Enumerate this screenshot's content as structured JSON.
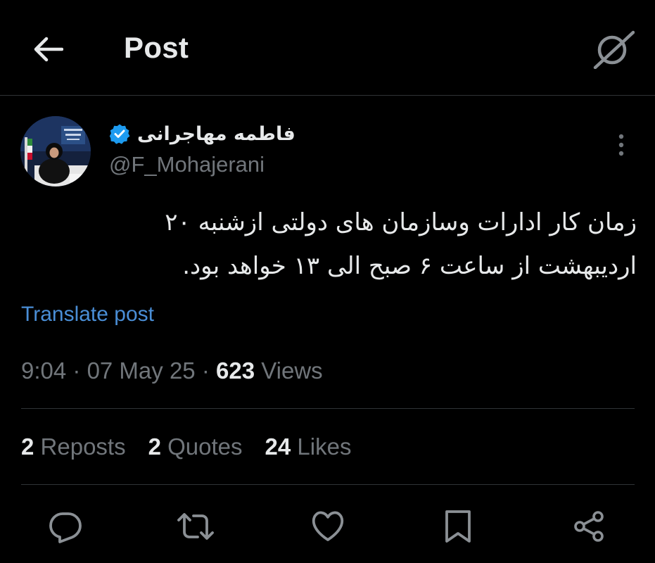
{
  "header": {
    "title": "Post",
    "back_icon": "arrow-left-icon",
    "grok_icon": "grok-icon"
  },
  "author": {
    "display_name": "فاطمه مهاجرانی",
    "handle": "@F_Mohajerani",
    "verified": true,
    "verified_color": "#1d9bf0"
  },
  "post": {
    "text": "زمان کار ادارات وسازمان های دولتی ازشنبه ۲۰ اردیبهشت از ساعت ۶ صبح الی ۱۳ خواهد بود.",
    "translate_label": "Translate post"
  },
  "meta": {
    "time": "9:04",
    "sep1": " · ",
    "date": "07 May 25",
    "sep2": " · ",
    "views_count": "623",
    "views_label": " Views"
  },
  "stats": {
    "reposts_count": "2",
    "reposts_label": " Reposts",
    "quotes_count": "2",
    "quotes_label": " Quotes",
    "likes_count": "24",
    "likes_label": " Likes"
  },
  "actions": [
    "reply-icon",
    "repost-icon",
    "like-icon",
    "bookmark-icon",
    "share-icon"
  ],
  "colors": {
    "background": "#000000",
    "text": "#e7e9ea",
    "muted": "#71767b",
    "link": "#4a8ed6",
    "divider": "#2f3336"
  }
}
